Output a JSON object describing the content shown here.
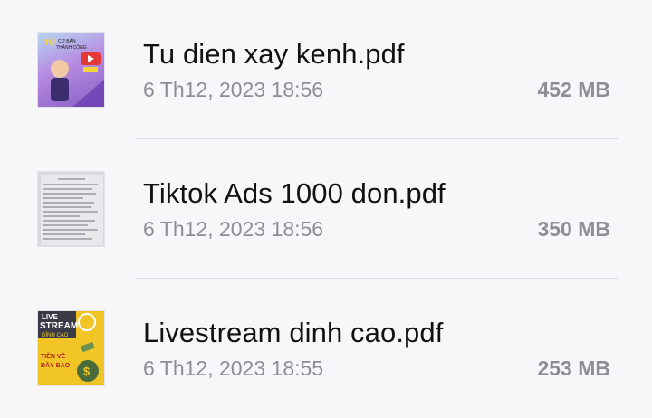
{
  "files": [
    {
      "name": "Tu dien xay kenh.pdf",
      "date": "6 Th12, 2023 18:56",
      "size": "452 MB",
      "thumbnail": "youtube-cover-thumbnail",
      "cover_text": [
        "CƠ BẢN",
        "THÀNH CÔNG"
      ]
    },
    {
      "name": "Tiktok Ads 1000 don.pdf",
      "date": "6 Th12, 2023 18:56",
      "size": "350 MB",
      "thumbnail": "document-page-thumbnail"
    },
    {
      "name": "Livestream dinh cao.pdf",
      "date": "6 Th12, 2023 18:55",
      "size": "253 MB",
      "thumbnail": "livestream-cover-thumbnail",
      "cover_text": [
        "LIVE",
        "STREAM",
        "ĐỈNH CAO",
        "TIỀN VỀ",
        "ĐẦY BAO"
      ]
    }
  ],
  "colors": {
    "background": "#f7f7fa",
    "name_text": "#111111",
    "meta_text": "#8d8d94",
    "divider": "#dcdce2"
  }
}
